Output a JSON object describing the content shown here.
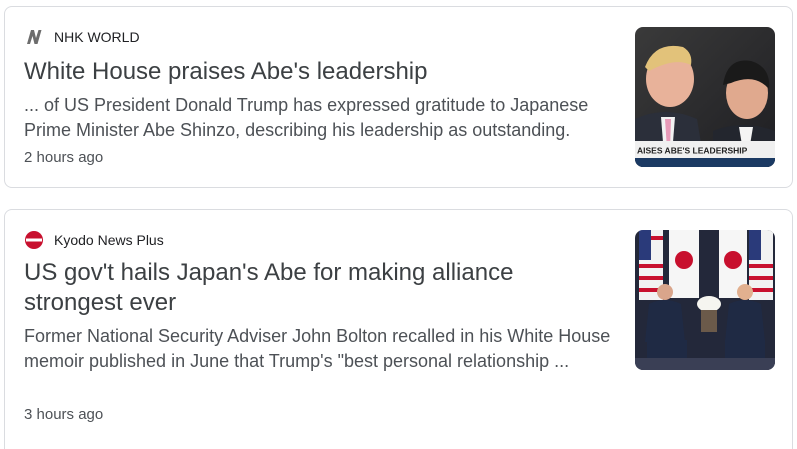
{
  "articles": [
    {
      "source": "NHK WORLD",
      "source_icon": "nhk-logo-icon",
      "headline": "White House praises Abe's leadership",
      "snippet": "... of US President Donald Trump has expressed gratitude to Japanese Prime Minister Abe Shinzo, describing his leadership as outstanding.",
      "time": "2 hours ago",
      "thumbnail_caption": "AISES ABE'S LEADERSHIP"
    },
    {
      "source": "Kyodo News Plus",
      "source_icon": "kyodo-logo-icon",
      "headline": "US gov't hails Japan's Abe for making alliance strongest ever",
      "snippet": "Former National Security Adviser John Bolton recalled in his White House memoir published in June that Trump's \"best personal relationship ...",
      "time": "3 hours ago"
    }
  ],
  "colors": {
    "border": "#dadce0",
    "headline": "#3c4043",
    "snippet": "#4d5156",
    "kyodo_red": "#c8102e"
  }
}
